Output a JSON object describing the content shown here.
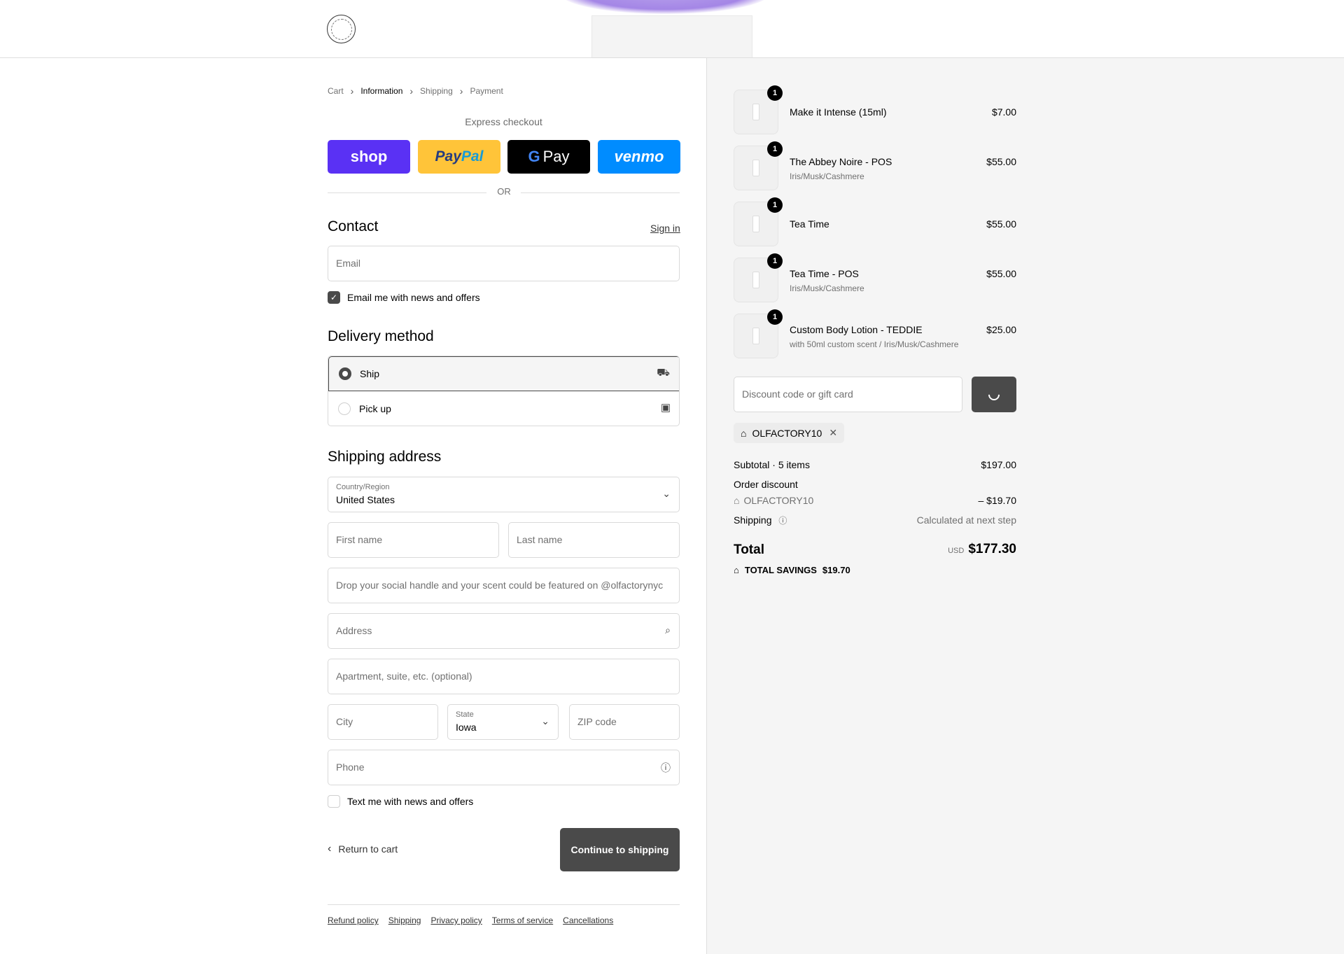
{
  "header": {
    "logo_text": "OLFACTORY NYC"
  },
  "breadcrumb": {
    "cart": "Cart",
    "information": "Information",
    "shipping": "Shipping",
    "payment": "Payment"
  },
  "express": {
    "label": "Express checkout",
    "shop": "shop",
    "paypal_a": "Pay",
    "paypal_b": "Pal",
    "gpay_g": "G",
    "gpay": "Pay",
    "venmo": "venmo",
    "or": "OR"
  },
  "contact": {
    "title": "Contact",
    "sign_in": "Sign in",
    "email_placeholder": "Email",
    "news_label": "Email me with news and offers",
    "news_checked": true
  },
  "delivery": {
    "title": "Delivery method",
    "ship": "Ship",
    "pickup": "Pick up",
    "selected": "Ship"
  },
  "shipping": {
    "title": "Shipping address",
    "country_label": "Country/Region",
    "country_value": "United States",
    "first_name": "First name",
    "last_name": "Last name",
    "social": "Drop your social handle and your scent could be featured on @olfactorynyc",
    "address": "Address",
    "apartment": "Apartment, suite, etc. (optional)",
    "city": "City",
    "state_label": "State",
    "state_value": "Iowa",
    "zip": "ZIP code",
    "phone": "Phone",
    "text_label": "Text me with news and offers",
    "text_checked": false
  },
  "actions": {
    "return": "Return to cart",
    "continue": "Continue to shipping"
  },
  "footer": {
    "links": [
      "Refund policy",
      "Shipping",
      "Privacy policy",
      "Terms of service",
      "Cancellations"
    ]
  },
  "summary": {
    "items": [
      {
        "name": "Make it Intense (15ml)",
        "variant": "",
        "price": "$7.00",
        "qty": "1"
      },
      {
        "name": "The Abbey Noire - POS",
        "variant": "Iris/Musk/Cashmere",
        "price": "$55.00",
        "qty": "1"
      },
      {
        "name": "Tea Time",
        "variant": "",
        "price": "$55.00",
        "qty": "1"
      },
      {
        "name": "Tea Time - POS",
        "variant": "Iris/Musk/Cashmere",
        "price": "$55.00",
        "qty": "1"
      },
      {
        "name": "Custom Body Lotion - TEDDIE",
        "variant": "with 50ml custom scent / Iris/Musk/Cashmere",
        "price": "$25.00",
        "qty": "1"
      }
    ],
    "discount_placeholder": "Discount code or gift card",
    "applied_code": "OLFACTORY10",
    "subtotal_label": "Subtotal · 5 items",
    "subtotal_value": "$197.00",
    "order_discount_label": "Order discount",
    "order_discount_code": "OLFACTORY10",
    "order_discount_value": "– $19.70",
    "shipping_label": "Shipping",
    "shipping_value": "Calculated at next step",
    "total_label": "Total",
    "currency": "USD",
    "total_value": "$177.30",
    "savings_label": "TOTAL SAVINGS",
    "savings_value": "$19.70"
  },
  "colors": {
    "primary_button": "#4a4a4a",
    "shop": "#5a31f4",
    "paypal": "#ffc439",
    "venmo": "#008cff",
    "panel": "#f5f5f5"
  }
}
